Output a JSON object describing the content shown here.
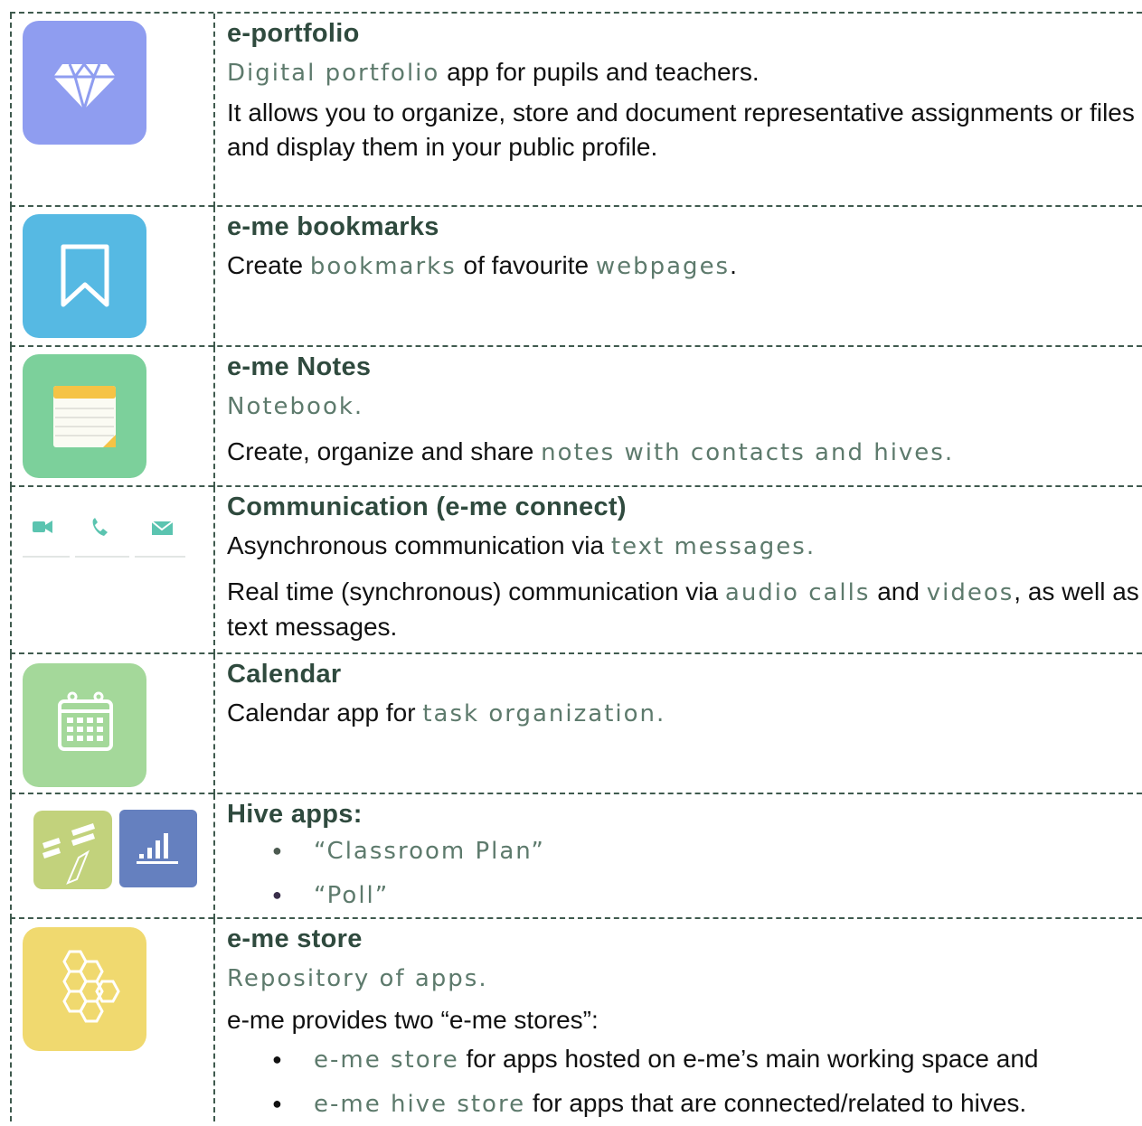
{
  "rows": [
    {
      "title": "e-portfolio",
      "line1": {
        "link": "Digital portfolio",
        "rest": " app for pupils and teachers."
      },
      "line2": "It allows you to organize, store and document representative assignments or files and display them in your public profile.",
      "icon": "diamond-icon",
      "color": "#8f9df0"
    },
    {
      "title": "e-me bookmarks",
      "line1": {
        "pre": "Create ",
        "link1": "bookmarks",
        "mid": " of favourite ",
        "link2": "webpages",
        "end": "."
      },
      "icon": "bookmark-icon",
      "color": "#56b9e3"
    },
    {
      "title": "e-me Notes",
      "line1": "Notebook.",
      "line2": {
        "pre": "Create, organize and share ",
        "link": "notes with contacts and hives."
      },
      "icon": "notepad-icon",
      "color": "#7cd09b"
    },
    {
      "title": "Communication (e-me connect)",
      "line1": {
        "pre": "Asynchronous communication via ",
        "link": "text messages."
      },
      "line2": {
        "pre": "Real time (synchronous) communication via ",
        "link1": "audio calls",
        "mid": " and ",
        "link2": "videos",
        "end": ", as well as text messages."
      },
      "icons": [
        "video-camera-icon",
        "phone-icon",
        "envelope-icon"
      ],
      "color": "#5bc4b0"
    },
    {
      "title": "Calendar",
      "line1": {
        "pre": "Calendar app for ",
        "link": "task organization."
      },
      "icon": "calendar-icon",
      "color": "#a4d89a"
    },
    {
      "title": "Hive apps:",
      "bullets": [
        "“Classroom Plan”",
        "“Poll”"
      ],
      "icons": [
        "classroom-plan-icon",
        "poll-icon"
      ],
      "colors": [
        "#c2d27c",
        "#6580bf"
      ]
    },
    {
      "title": "e-me store",
      "line1": "Repository of apps.",
      "line2": "e-me provides two “e-me stores”:",
      "bullets": [
        {
          "link": "e-me store",
          "rest": " for apps hosted on e-me’s main working space and"
        },
        {
          "link": "e-me hive store",
          "rest": " for apps that are connected/related to hives."
        }
      ],
      "icon": "honeycomb-icon",
      "color": "#f0d96f"
    }
  ]
}
